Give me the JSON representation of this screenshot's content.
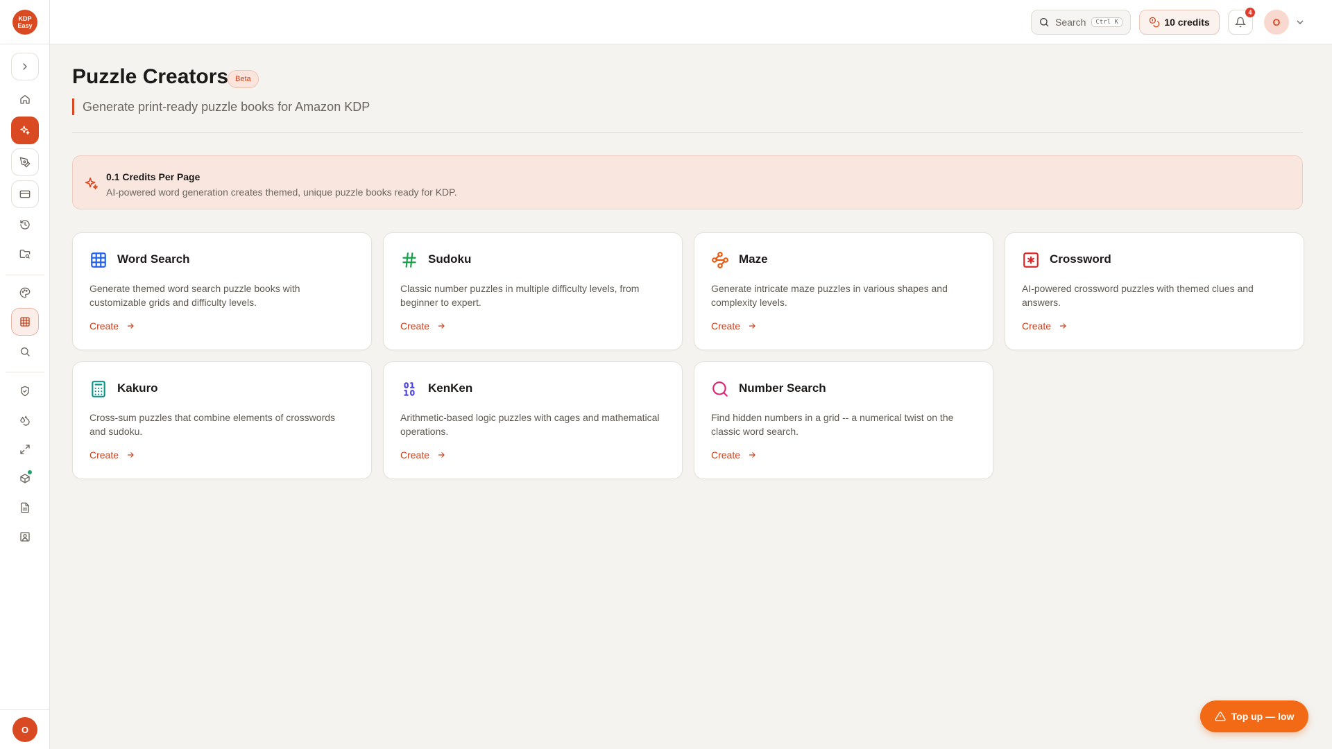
{
  "brand": {
    "logo_line1": "KDP",
    "logo_line2": "Easy",
    "accent": "#d94a22"
  },
  "topbar": {
    "search_label": "Search",
    "search_shortcut": "Ctrl K",
    "credits_label": "10 credits",
    "notification_count": "4",
    "avatar_initial": "O"
  },
  "sidebar": {
    "user_initial": "O",
    "items": [
      {
        "icon": "chevron-right-icon"
      },
      {
        "icon": "home-icon"
      },
      {
        "icon": "sparkles-icon"
      },
      {
        "icon": "pen-tool-icon"
      },
      {
        "icon": "credit-card-icon"
      },
      {
        "icon": "history-icon"
      },
      {
        "icon": "folder-search-icon"
      },
      {
        "icon": "palette-icon"
      },
      {
        "icon": "grid-icon"
      },
      {
        "icon": "search-icon"
      },
      {
        "icon": "shield-check-icon"
      },
      {
        "icon": "droplets-icon"
      },
      {
        "icon": "expand-icon"
      },
      {
        "icon": "package-icon"
      },
      {
        "icon": "file-text-icon"
      },
      {
        "icon": "contact-icon"
      }
    ]
  },
  "page": {
    "title": "Puzzle Creators",
    "badge": "Beta",
    "subtitle": "Generate print-ready puzzle books for Amazon KDP"
  },
  "info": {
    "title": "0.1 Credits Per Page",
    "description": "AI-powered word generation creates themed, unique puzzle books ready for KDP."
  },
  "cards": [
    {
      "title": "Word Search",
      "description": "Generate themed word search puzzle books with customizable grids and difficulty levels.",
      "cta": "Create",
      "color": "#2563eb",
      "icon": "grid-icon"
    },
    {
      "title": "Sudoku",
      "description": "Classic number puzzles in multiple difficulty levels, from beginner to expert.",
      "cta": "Create",
      "color": "#16a34a",
      "icon": "hash-icon"
    },
    {
      "title": "Maze",
      "description": "Generate intricate maze puzzles in various shapes and complexity levels.",
      "cta": "Create",
      "color": "#ea580c",
      "icon": "waypoints-icon"
    },
    {
      "title": "Crossword",
      "description": "AI-powered crossword puzzles with themed clues and answers.",
      "cta": "Create",
      "color": "#dc2626",
      "icon": "square-asterisk-icon"
    },
    {
      "title": "Kakuro",
      "description": "Cross-sum puzzles that combine elements of crosswords and sudoku.",
      "cta": "Create",
      "color": "#0d9488",
      "icon": "calculator-icon"
    },
    {
      "title": "KenKen",
      "description": "Arithmetic-based logic puzzles with cages and mathematical operations.",
      "cta": "Create",
      "color": "#4f46e5",
      "icon": "binary-icon"
    },
    {
      "title": "Number Search",
      "description": "Find hidden numbers in a grid -- a numerical twist on the classic word search.",
      "cta": "Create",
      "color": "#db2777",
      "icon": "search-icon"
    }
  ],
  "topup": {
    "label": "Top up — low"
  }
}
